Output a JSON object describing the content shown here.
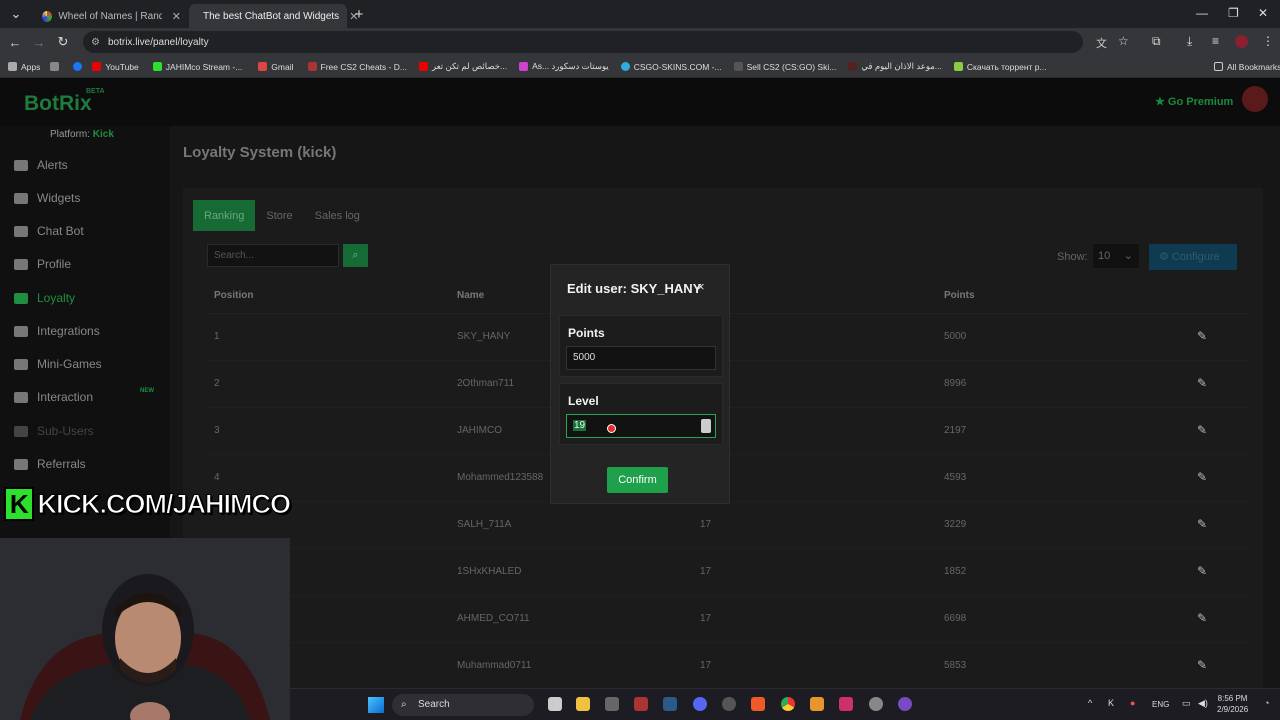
{
  "browser": {
    "tabs": [
      {
        "label": "Wheel of Names | Random nam",
        "active": false
      },
      {
        "label": "The best ChatBot and Widgets",
        "active": true
      }
    ],
    "new_tab": "+",
    "url": "botrix.live/panel/loyalty",
    "bookmarks": [
      "Apps",
      "YouTube",
      "JAHIMco Stream -...",
      "Gmail",
      "Free CS2 Cheats - D...",
      "خصائص لم تكن تعر...",
      "As... يوستات دسكورد",
      "CSGO-SKINS.COM -...",
      "Sell CS2 (CS:GO) Ski...",
      "موعد الاذان اليوم في...",
      "Скачать торрент р...",
      "All Bookmarks"
    ]
  },
  "header": {
    "logo": "BotRix",
    "beta": "BETA",
    "premium": "Go Premium"
  },
  "sidebar": {
    "platform_label": "Platform:",
    "platform_value": "Kick",
    "items": [
      {
        "label": "Alerts"
      },
      {
        "label": "Widgets"
      },
      {
        "label": "Chat Bot"
      },
      {
        "label": "Profile"
      },
      {
        "label": "Loyalty"
      },
      {
        "label": "Integrations"
      },
      {
        "label": "Mini-Games"
      },
      {
        "label": "Interaction"
      },
      {
        "label": "Sub-Users"
      },
      {
        "label": "Referrals"
      }
    ],
    "new_badge": "NEW"
  },
  "page": {
    "title": "Loyalty System (kick)",
    "tabs": [
      "Ranking",
      "Store",
      "Sales log"
    ],
    "search_placeholder": "Search...",
    "show_label": "Show:",
    "show_value": "10",
    "configure_label": "Configure"
  },
  "table": {
    "headers": {
      "position": "Position",
      "name": "Name",
      "points": "Points"
    },
    "rows": [
      {
        "position": "1",
        "name": "SKY_HANY",
        "level": "",
        "points": "5000"
      },
      {
        "position": "2",
        "name": "2Othman711",
        "level": "",
        "points": "8996"
      },
      {
        "position": "3",
        "name": "JAHIMCO",
        "level": "",
        "points": "2197"
      },
      {
        "position": "4",
        "name": "Mohammed123588",
        "level": "",
        "points": "4593"
      },
      {
        "position": "",
        "name": "SALH_711A",
        "level": "17",
        "points": "3229"
      },
      {
        "position": "",
        "name": "1SHxKHALED",
        "level": "17",
        "points": "1852"
      },
      {
        "position": "",
        "name": "AHMED_CO711",
        "level": "17",
        "points": "6698"
      },
      {
        "position": "",
        "name": "Muhammad0711",
        "level": "17",
        "points": "5853"
      }
    ]
  },
  "modal": {
    "title": "Edit user: SKY_HANY",
    "close": "×",
    "points_label": "Points",
    "points_value": "5000",
    "level_label": "Level",
    "level_value": "19",
    "confirm_label": "Confirm"
  },
  "overlay": {
    "kick_text": "KICK.COM/JAHIMCO",
    "kick_logo": "K"
  },
  "taskbar": {
    "search_label": "Search",
    "lang": "ENG",
    "time": "8:56 PM",
    "date": "2/9/2026"
  }
}
